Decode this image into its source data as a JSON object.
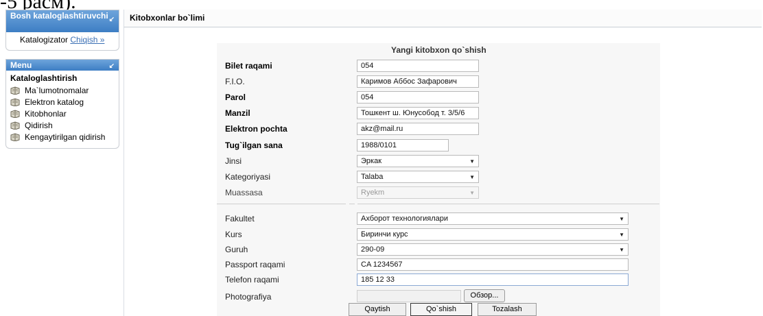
{
  "caption": "-5 расм).",
  "sidebar": {
    "box1": {
      "header": "Bosh kataloglashtiruvchi",
      "role": "Katalogizator",
      "logout": "Chiqish »"
    },
    "box2": {
      "header": "Menu",
      "title": "Kataloglashtirish",
      "items": [
        {
          "label": "Ma`lumotnomalar",
          "icon": "book-icon"
        },
        {
          "label": "Elektron katalog",
          "icon": "book-icon"
        },
        {
          "label": "Kitobhonlar",
          "icon": "book-icon"
        },
        {
          "label": "Qidirish",
          "icon": "book-icon"
        },
        {
          "label": "Kengaytirilgan qidirish",
          "icon": "book-icon"
        }
      ]
    }
  },
  "main": {
    "title": "Kitobxonlar bo`limi"
  },
  "form": {
    "title": "Yangi kitobxon qo`shish",
    "bilet_label": "Bilet raqami",
    "bilet_value": "054",
    "fio_label": "F.I.O.",
    "fio_value": "Каримов Аббос Зафарович",
    "parol_label": "Parol",
    "parol_value": "054",
    "manzil_label": "Manzil",
    "manzil_value": "Тошкент ш. Юнусобод т. 3/5/6",
    "email_label": "Elektron pochta",
    "email_value": "akz@mail.ru",
    "birth_label": "Tug`ilgan sana",
    "birth_value": "1988/0101",
    "jinsi_label": "Jinsi",
    "jinsi_value": "Эркак",
    "kategoriya_label": "Kategoriyasi",
    "kategoriya_value": "Talaba",
    "muassasa_label": "Muassasa",
    "muassasa_value": "Ryekm",
    "fakultet_label": "Fakultet",
    "fakultet_value": "Ахборот технологиялари",
    "kurs_label": "Kurs",
    "kurs_value": "Биринчи курс",
    "guruh_label": "Guruh",
    "guruh_value": "290-09",
    "passport_label": "Passport raqami",
    "passport_value": "CA 1234567",
    "telefon_label": "Telefon raqami",
    "telefon_value": "185 12 33",
    "photo_label": "Photografiya",
    "photo_value": "",
    "browse_label": "Обзор...",
    "buttons": {
      "back": "Qaytish",
      "add": "Qo`shish",
      "clear": "Tozalash"
    }
  },
  "colors": {
    "header_blue": "#3d7ec4",
    "link": "#3a6fb4"
  }
}
